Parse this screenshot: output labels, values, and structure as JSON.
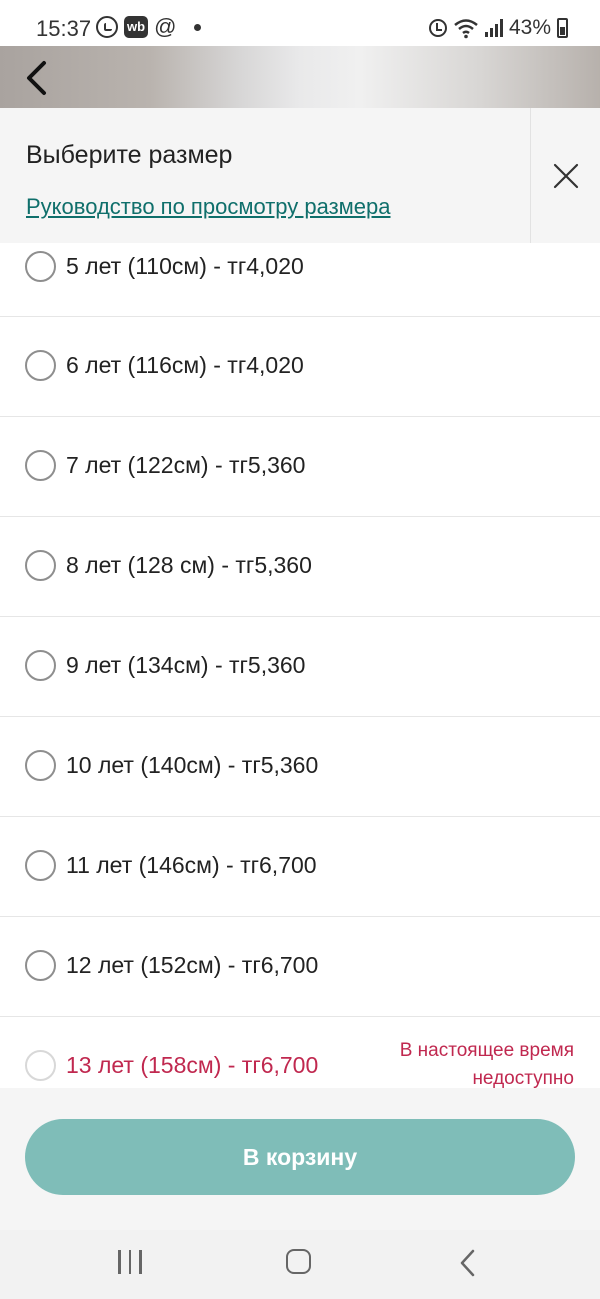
{
  "status_bar": {
    "time": "15:37",
    "wb_badge": "wb",
    "at_sign": "@",
    "battery_percent": "43%"
  },
  "sheet": {
    "title": "Выберите размер",
    "size_guide_link": "Руководство по просмотру размера"
  },
  "options": [
    {
      "label": "5 лет (110см) - тг4,020",
      "available": true
    },
    {
      "label": "6 лет (116см) - тг4,020",
      "available": true
    },
    {
      "label": "7 лет (122см) - тг5,360",
      "available": true
    },
    {
      "label": "8 лет (128 см) - тг5,360",
      "available": true
    },
    {
      "label": "9 лет (134см) - тг5,360",
      "available": true
    },
    {
      "label": "10 лет (140см) - тг5,360",
      "available": true
    },
    {
      "label": "11 лет (146см) - тг6,700",
      "available": true
    },
    {
      "label": "12 лет (152см) - тг6,700",
      "available": true
    },
    {
      "label": "13 лет (158см) - тг6,700",
      "available": false,
      "note_line1": "В настоящее время",
      "note_line2": "недоступно"
    }
  ],
  "footer": {
    "cart_button_label": "В корзину"
  },
  "colors": {
    "accent": "#7fbdb8",
    "link": "#0f6f6b",
    "unavailable": "#c0284f"
  },
  "icons": [
    "whatsapp-icon",
    "wb-icon",
    "at-icon",
    "alarm-icon",
    "wifi-icon",
    "signal-icon",
    "battery-icon",
    "back-arrow-icon",
    "close-icon",
    "recents-icon",
    "home-icon",
    "nav-back-icon"
  ]
}
